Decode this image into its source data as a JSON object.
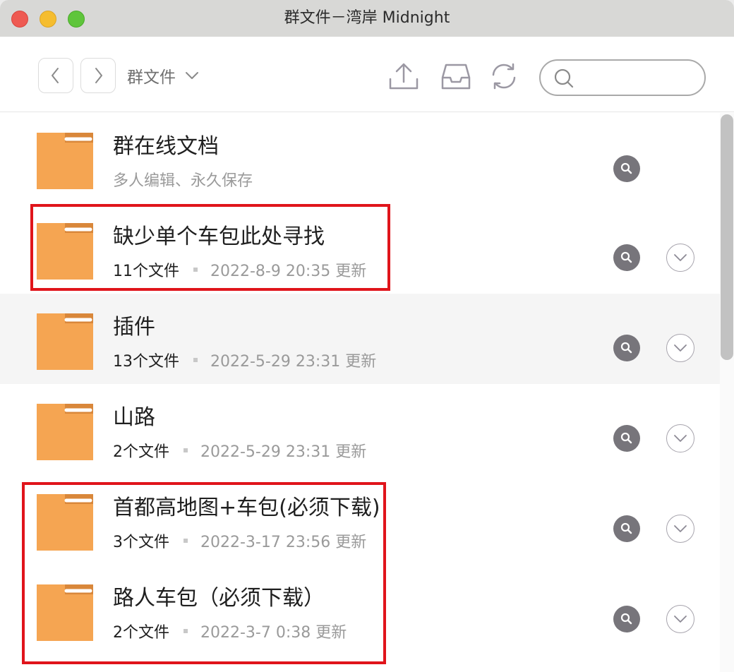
{
  "window": {
    "title": "群文件－湾岸 Midnight"
  },
  "toolbar": {
    "back_icon": "chevron-left-icon",
    "forward_icon": "chevron-right-icon",
    "breadcrumb_label": "群文件",
    "breadcrumb_icon": "chevron-down-icon",
    "upload_icon": "upload-icon",
    "inbox_icon": "inbox-icon",
    "refresh_icon": "refresh-icon",
    "search_icon": "search-icon",
    "search_value": ""
  },
  "rows": [
    {
      "title": "群在线文档",
      "subtitle": "多人编辑、永久保存",
      "has_expand": false
    },
    {
      "title": "缺少单个车包此处寻找",
      "count": "11个文件",
      "date": "2022-8-9 20:35 更新",
      "has_expand": true
    },
    {
      "title": "插件",
      "count": "13个文件",
      "date": "2022-5-29 23:31 更新",
      "has_expand": true,
      "hovered": true
    },
    {
      "title": "山路",
      "count": "2个文件",
      "date": "2022-5-29 23:31 更新",
      "has_expand": true
    },
    {
      "title": "首都高地图+车包(必须下载)",
      "count": "3个文件",
      "date": "2022-3-17 23:56 更新",
      "has_expand": true
    },
    {
      "title": "路人车包（必须下载）",
      "count": "2个文件",
      "date": "2022-3-7 0:38 更新",
      "has_expand": true
    }
  ],
  "colors": {
    "folder": "#f5a552",
    "folder_tab": "#d9873a",
    "highlight": "#e0141b",
    "action_button": "#77757b"
  }
}
